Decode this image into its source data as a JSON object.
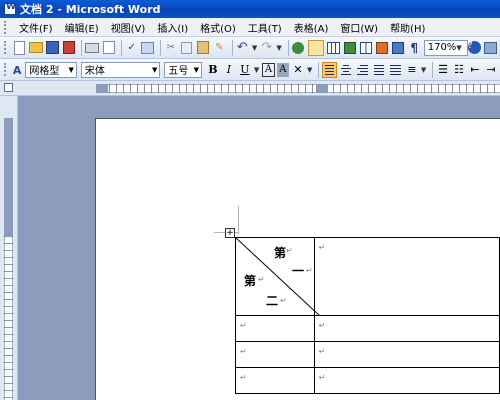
{
  "window": {
    "title": "文档 2 - Microsoft Word"
  },
  "menu": [
    "文件(F)",
    "编辑(E)",
    "视图(V)",
    "插入(I)",
    "格式(O)",
    "工具(T)",
    "表格(A)",
    "窗口(W)",
    "帮助(H)"
  ],
  "toolbar": {
    "zoom": "170%"
  },
  "format": {
    "style": "网格型",
    "font": "宋体",
    "size": "五号"
  },
  "table": {
    "header_top": "第",
    "header_top2": "一",
    "header_left": "第",
    "header_left2": "二",
    "para_mark": "↵"
  }
}
